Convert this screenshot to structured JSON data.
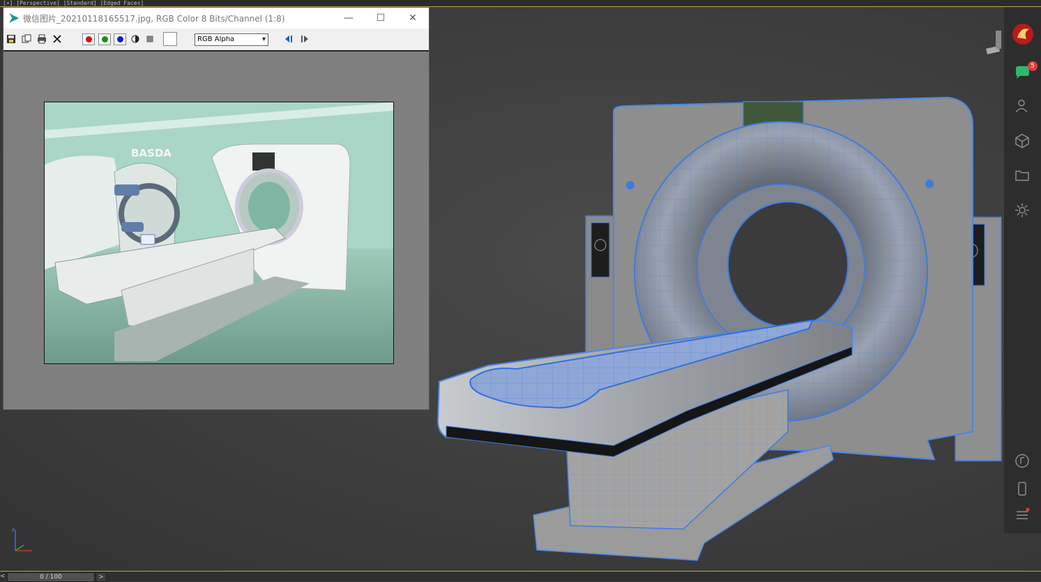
{
  "top_strip_text": "[+] [Perspective] [Standard] [Edged Faces]",
  "framebuffer": {
    "title": "微信图片_20210118165517.jpg, RGB Color 8 Bits/Channel (1:8)",
    "minimize": "—",
    "maximize": "☐",
    "close": "✕",
    "channel_select": "RGB Alpha",
    "image_logo_text": "BASDA"
  },
  "side_panel": {
    "notification_count": "5"
  },
  "timeline": {
    "frame_counter": "0 / 100",
    "next": ">",
    "prev": "<"
  },
  "colors": {
    "wire_blue": "#3d7be0",
    "channel_red": "#d01010",
    "channel_green": "#129012",
    "channel_blue": "#1020c8",
    "badge_red": "#e23b3b",
    "accent_gold": "#c8a632"
  }
}
